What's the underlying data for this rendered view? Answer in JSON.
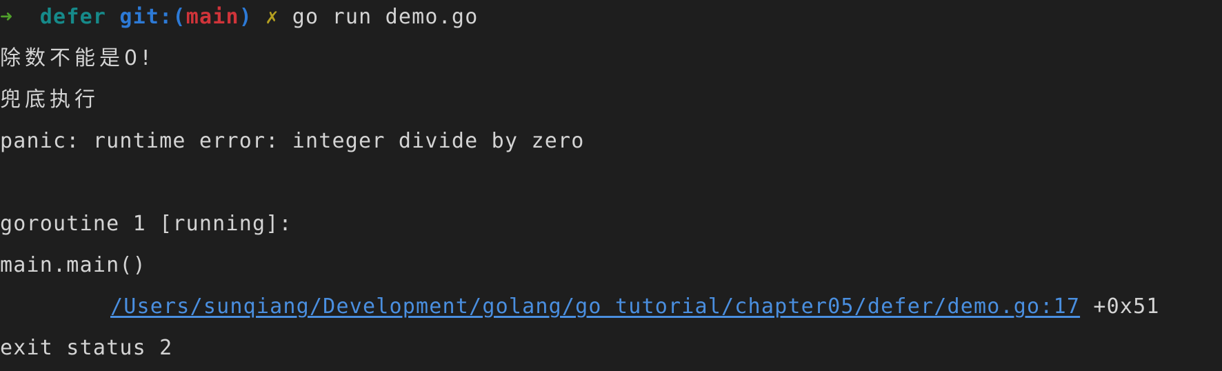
{
  "prompt": {
    "arrow": "➜",
    "directory": "defer",
    "git_label": "git:(",
    "branch": "main",
    "git_close": ")",
    "dirty_marker": "✗",
    "command": "go run demo.go"
  },
  "output": {
    "line1": "除数不能是0!",
    "line2": "兜底执行",
    "panic": "panic: runtime error: integer divide by zero",
    "goroutine": "goroutine 1 [running]:",
    "func": "main.main()",
    "file_path": "/Users/sunqiang/Development/golang/go_tutorial/chapter05/defer/demo.go:17",
    "file_offset": "+0x51",
    "exit": "exit status 2"
  },
  "colors": {
    "background": "#1e1e1e",
    "text": "#d4d4d4",
    "arrow": "#4fa02b",
    "directory": "#168a8a",
    "git": "#2d7ad6",
    "branch": "#d0343a",
    "dirty": "#b5a020",
    "link": "#4a8fe0"
  }
}
